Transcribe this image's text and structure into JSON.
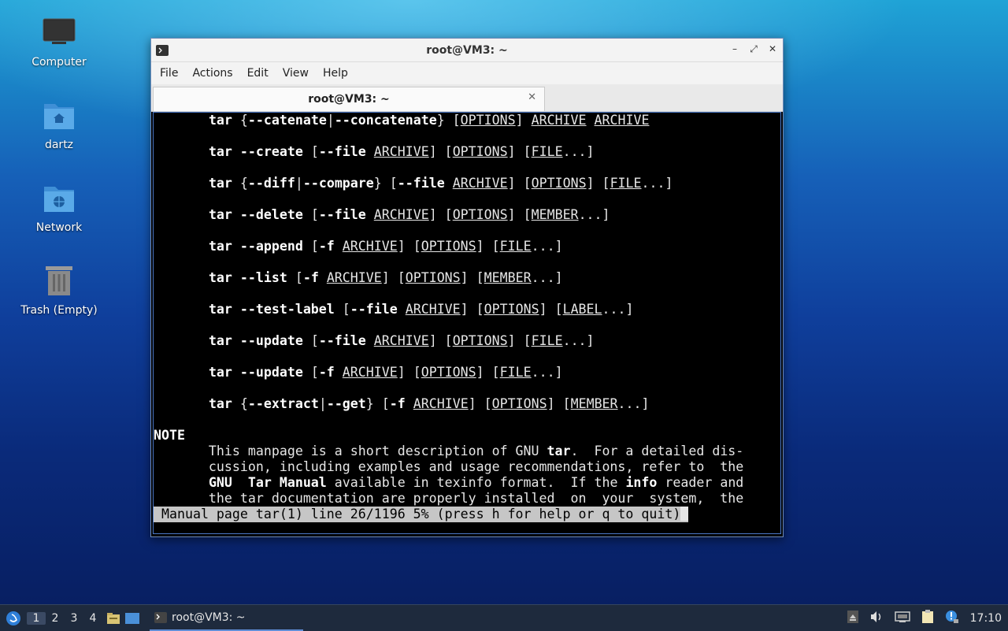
{
  "desktop": {
    "icons": [
      {
        "label": "Computer",
        "icon": "computer-icon"
      },
      {
        "label": "dartz",
        "icon": "home-folder-icon"
      },
      {
        "label": "Network",
        "icon": "network-folder-icon"
      },
      {
        "label": "Trash (Empty)",
        "icon": "trash-icon"
      }
    ]
  },
  "window": {
    "title": "root@VM3: ~",
    "menu": [
      "File",
      "Actions",
      "Edit",
      "View",
      "Help"
    ],
    "tab_label": "root@VM3: ~"
  },
  "terminal": {
    "lines": [
      {
        "indent": "       ",
        "html": "<b>tar</b> {<b>--catenate</b>|<b>--concatenate</b>} [<u>OPTIONS</u>] <u>ARCHIVE</u> <u>ARCHIVE</u>"
      },
      {
        "indent": "       ",
        "html": "<b>tar --create</b> [<b>--file</b> <u>ARCHIVE</u>] [<u>OPTIONS</u>] [<u>FILE</u>...]"
      },
      {
        "indent": "       ",
        "html": "<b>tar</b> {<b>--diff</b>|<b>--compare</b>} [<b>--file</b> <u>ARCHIVE</u>] [<u>OPTIONS</u>] [<u>FILE</u>...]"
      },
      {
        "indent": "       ",
        "html": "<b>tar --delete</b> [<b>--file</b> <u>ARCHIVE</u>] [<u>OPTIONS</u>] [<u>MEMBER</u>...]"
      },
      {
        "indent": "       ",
        "html": "<b>tar --append</b> [<b>-f</b> <u>ARCHIVE</u>] [<u>OPTIONS</u>] [<u>FILE</u>...]"
      },
      {
        "indent": "       ",
        "html": "<b>tar --list</b> [<b>-f</b> <u>ARCHIVE</u>] [<u>OPTIONS</u>] [<u>MEMBER</u>...]"
      },
      {
        "indent": "       ",
        "html": "<b>tar --test-label</b> [<b>--file</b> <u>ARCHIVE</u>] [<u>OPTIONS</u>] [<u>LABEL</u>...]"
      },
      {
        "indent": "       ",
        "html": "<b>tar --update</b> [<b>--file</b> <u>ARCHIVE</u>] [<u>OPTIONS</u>] [<u>FILE</u>...]"
      },
      {
        "indent": "       ",
        "html": "<b>tar --update</b> [<b>-f</b> <u>ARCHIVE</u>] [<u>OPTIONS</u>] [<u>FILE</u>...]"
      },
      {
        "indent": "       ",
        "html": "<b>tar</b> {<b>--extract</b>|<b>--get</b>} [<b>-f</b> <u>ARCHIVE</u>] [<u>OPTIONS</u>] [<u>MEMBER</u>...]"
      }
    ],
    "note_heading": "NOTE",
    "note_lines": [
      "This manpage is a short description of GNU <b>tar</b>.  For a detailed dis-",
      "cussion, including examples and usage recommendations, refer to  the",
      "<b>GNU  Tar Manual</b> available in texinfo format.  If the <b>info</b> reader and",
      "the tar documentation are properly installed  on  your  system,  the"
    ],
    "status": " Manual page tar(1) line 26/1196 5% (press h for help or q to quit)"
  },
  "taskbar": {
    "workspaces": [
      "1",
      "2",
      "3",
      "4"
    ],
    "active_workspace": "1",
    "task_label": "root@VM3: ~",
    "clock": "17:10"
  }
}
